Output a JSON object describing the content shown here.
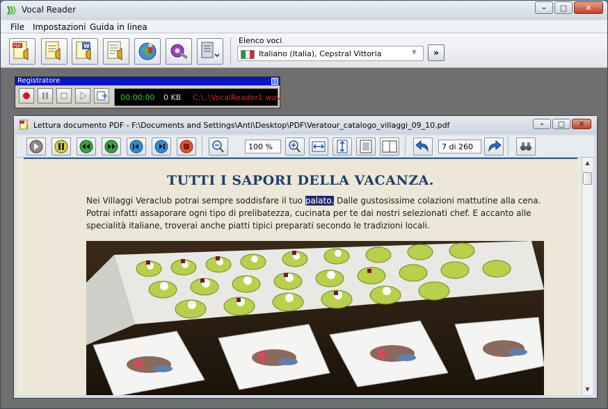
{
  "window": {
    "title": "Vocal Reader",
    "caption": {
      "minimize": "–",
      "maximize": "□",
      "close": "✕"
    }
  },
  "menu": [
    {
      "label": "File"
    },
    {
      "label": "Impostazioni"
    },
    {
      "label": "Guida in linea"
    }
  ],
  "voices": {
    "label": "Elenco voci",
    "selected": "Italiano (Italia), Cepstral Vittoria",
    "flag_colors": [
      "#1a9a3a",
      "#ffffff",
      "#d42a2a"
    ]
  },
  "recorder": {
    "title": "Registratore",
    "help": "?",
    "time": "00:00:00",
    "size": "0 KB",
    "file": "C:\\..\\VocalReader1.wav"
  },
  "document": {
    "title": "Lettura documento PDF - F:\\Documents and Settings\\Anti\\Desktop\\PDF\\Veratour_catalogo_villaggi_09_10.pdf",
    "zoom": "100 %",
    "page": "7 di 260",
    "heading": "TUTTI I SAPORI DELLA VACANZA.",
    "text_before": "Nei Villaggi Veraclub potrai sempre soddisfare il tuo ",
    "highlighted_word": "palato.",
    "text_after": " Dalle gustosissime colazioni mattutine alla cena. Potrai infatti assaporare ogni tipo di prelibatezza, cucinata per te dai nostri selezionati chef. E accanto alle specialità italiane, troverai anche piatti tipici preparati secondo le tradizioni locali."
  },
  "colors": {
    "accent_blue": "#1b3e6e",
    "recorder_bar": "#0a14c8",
    "highlight": "#1c2a6e"
  }
}
